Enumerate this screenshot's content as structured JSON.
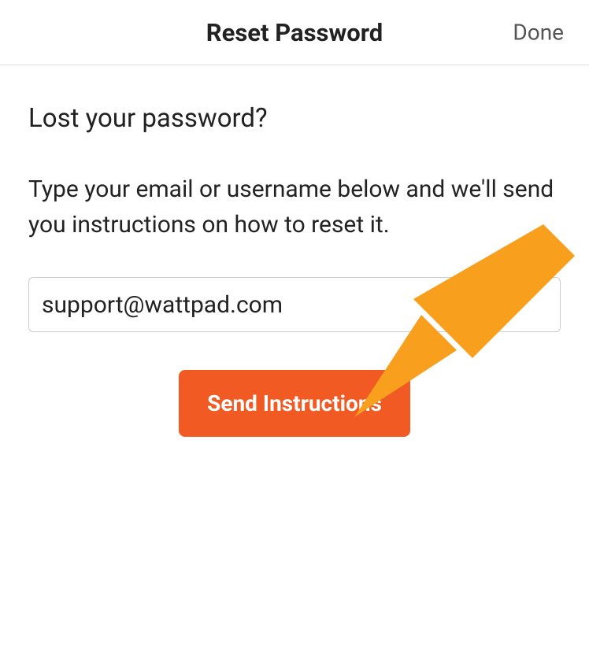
{
  "header": {
    "title": "Reset Password",
    "done_label": "Done"
  },
  "content": {
    "heading": "Lost your password?",
    "instructions": "Type your email or username below and we'll send you instructions on how to reset it.",
    "email_value": "support@wattpad.com",
    "send_button_label": "Send Instructions"
  },
  "colors": {
    "accent": "#f15a22",
    "arrow": "#f8a01e"
  }
}
